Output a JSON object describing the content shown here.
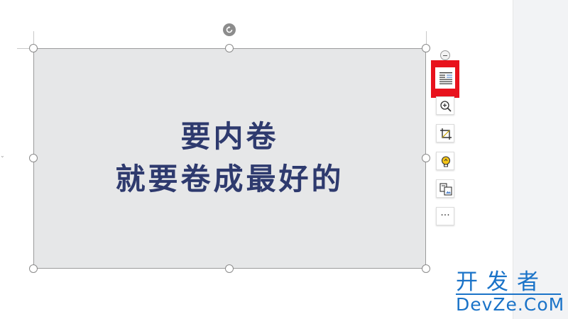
{
  "slide": {
    "image_text_line1": "要内卷",
    "image_text_line2": "就要卷成最好的"
  },
  "toolbar": {
    "icons": [
      "layout-options-icon",
      "zoom-in-icon",
      "crop-icon",
      "smart-idea-icon",
      "convert-image-icon",
      "more-icon"
    ],
    "more_label": "···",
    "highlight_color": "#e8121d"
  },
  "watermark": {
    "cn": "开发者",
    "en": "DevZe.CoM",
    "color": "#1a73c8"
  },
  "colors": {
    "image_bg": "#e6e7e8",
    "image_text": "#2e3a6e"
  }
}
